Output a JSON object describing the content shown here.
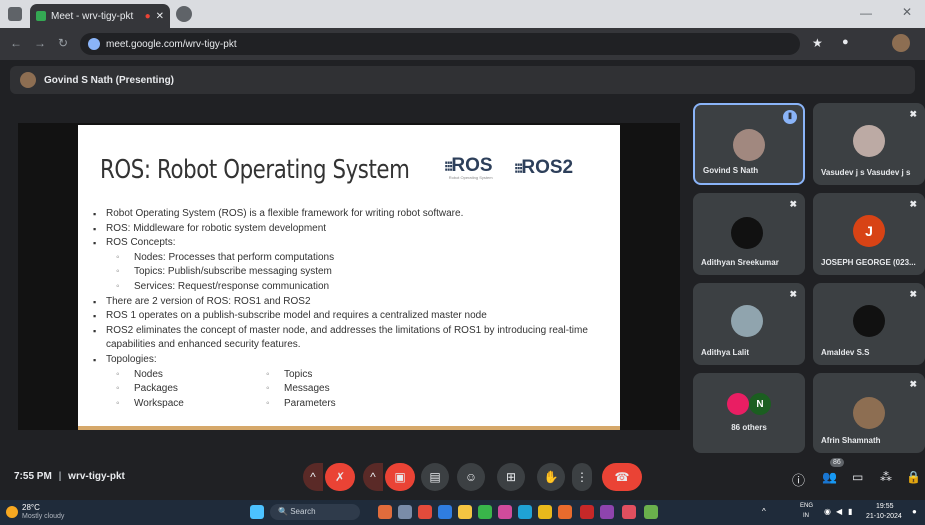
{
  "browser": {
    "tab_title": "Meet - wrv-tigy-pkt",
    "url": "meet.google.com/wrv-tigy-pkt"
  },
  "meet": {
    "presenter_label": "Govind S Nath (Presenting)",
    "meeting_time": "7:55 PM",
    "meeting_code": "wrv-tigy-pkt",
    "others_badge": "86"
  },
  "slide": {
    "title": "ROS: Robot Operating System",
    "logo_ros": "ROS",
    "logo_ros_sub": "Robot Operating System",
    "logo_ros2": "ROS2",
    "bullets": [
      "Robot Operating System (ROS) is a flexible framework for writing robot software.",
      "ROS: Middleware for robotic system development",
      "ROS Concepts:"
    ],
    "concepts": [
      "Nodes: Processes that perform computations",
      "Topics: Publish/subscribe messaging system",
      "Services: Request/response communication"
    ],
    "bullets2": [
      "There are 2 version of ROS: ROS1 and ROS2",
      "ROS 1 operates on a publish-subscribe model and requires a centralized master node",
      "ROS2 eliminates the concept of master node, and addresses the limitations of ROS1 by introducing real-time capabilities and enhanced security features.",
      "Topologies:"
    ],
    "topologies_col1": [
      "Nodes",
      "Packages",
      "Workspace"
    ],
    "topologies_col2": [
      "Topics",
      "Messages",
      "Parameters"
    ]
  },
  "participants": [
    {
      "name": "Govind S Nath"
    },
    {
      "name": "Vasudev j s Vasudev j s"
    },
    {
      "name": "Adithyan Sreekumar"
    },
    {
      "name": "JOSEPH GEORGE (023..."
    },
    {
      "name": "Adithya Lalit"
    },
    {
      "name": "Amaldev S.S"
    },
    {
      "name": "86 others",
      "initial_n": "N"
    },
    {
      "name": "Afrin Shamnath"
    }
  ],
  "joseph_initial": "J",
  "taskbar": {
    "weather_temp": "28°C",
    "weather_desc": "Mostly cloudy",
    "search_placeholder": "Search",
    "lang": "ENG",
    "region": "IN",
    "time": "19:55",
    "date": "21-10-2024"
  },
  "colors": {
    "meet_red": "#ea4335",
    "accent_blue": "#8ab4f8",
    "slide_accent": "#d6a86a"
  }
}
